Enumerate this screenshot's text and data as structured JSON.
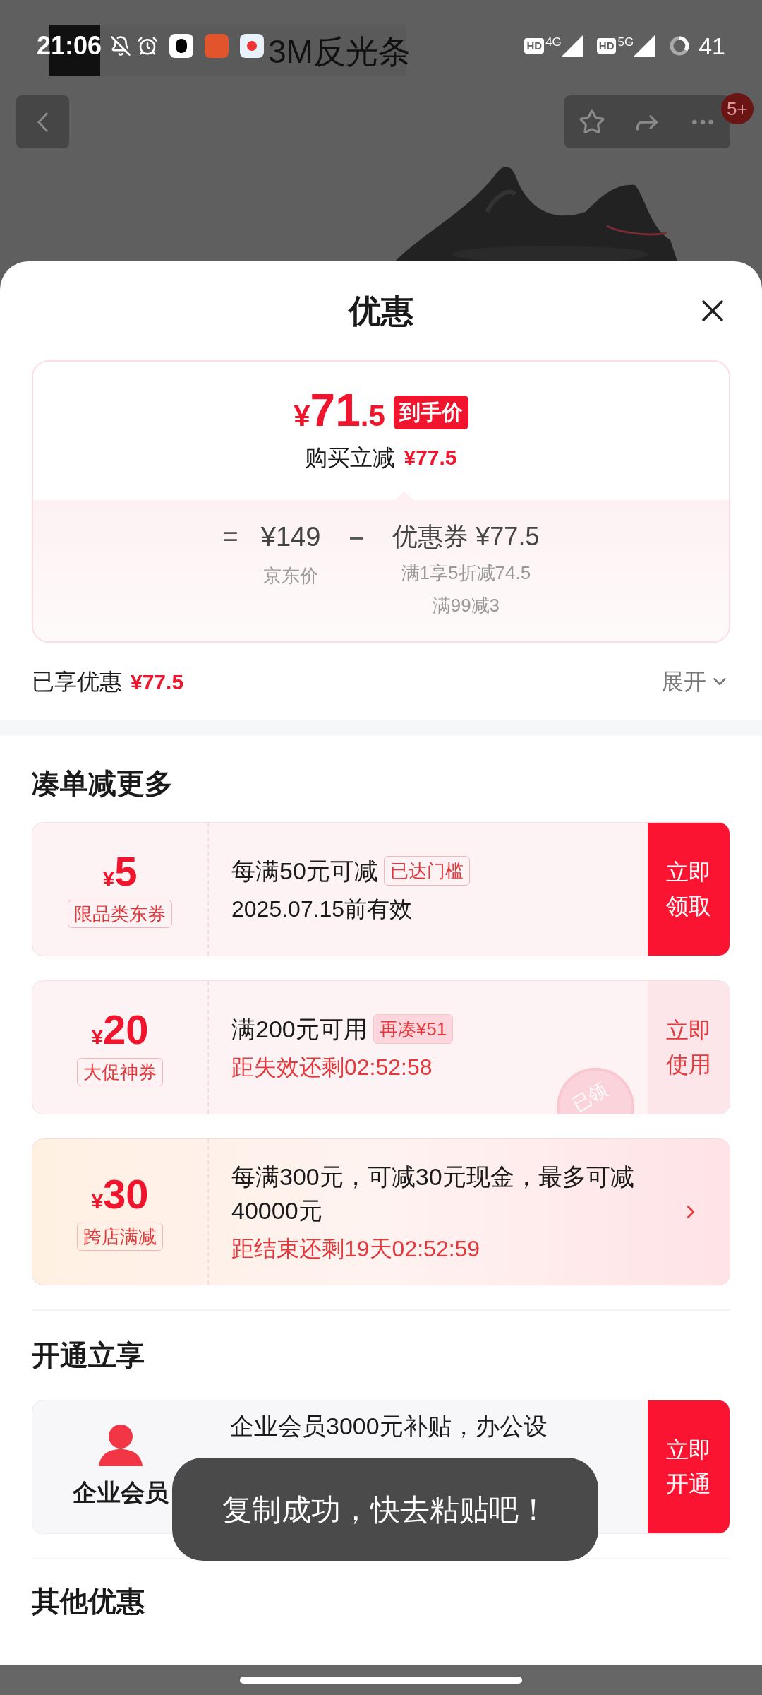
{
  "status_bar": {
    "time": "21:06",
    "signals": [
      {
        "hd": "HD",
        "type": "4G"
      },
      {
        "hd": "HD",
        "type": "5G"
      }
    ],
    "battery": "41"
  },
  "product_page": {
    "banner_text": "3M反光条",
    "badge": "5+"
  },
  "sheet": {
    "title": "优惠",
    "price_card": {
      "symbol": "¥",
      "integer": "71",
      "decimal": ".5",
      "final_label": "到手价",
      "instant_label": "购买立减",
      "instant_value": "¥77.5",
      "formula": {
        "equals": "=",
        "base_price": "¥149",
        "base_label": "京东价",
        "minus": "－",
        "discount": "优惠券 ¥77.5",
        "discount_details": [
          "满1享5折减74.5",
          "满99减3"
        ]
      }
    },
    "enjoyed": {
      "label": "已享优惠",
      "value": "¥77.5",
      "expand": "展开"
    },
    "bundle_section": {
      "title": "凑单减更多",
      "coupons": [
        {
          "kind": "ticket",
          "symbol": "¥",
          "amount": "5",
          "tag": "限品类东券",
          "title": "每满50元可减",
          "badge": "已达门槛",
          "badge_outlined": true,
          "subtitle": "2025.07.15前有效",
          "subtitle_alert": false,
          "action": "立即领取",
          "action_solid": true
        },
        {
          "kind": "ticket",
          "symbol": "¥",
          "amount": "20",
          "tag": "大促神券",
          "title": "满200元可用",
          "badge": "再凑¥51",
          "badge_outlined": false,
          "subtitle": "距失效还剩02:52:58",
          "subtitle_alert": true,
          "action": "立即使用",
          "action_solid": false,
          "stamp": "已领"
        },
        {
          "kind": "promo",
          "symbol": "¥",
          "amount": "30",
          "tag": "跨店满减",
          "title": "每满300元，可减30元现金，最多可减40000元",
          "subtitle": "距结束还剩19天02:52:59",
          "subtitle_alert": true
        }
      ]
    },
    "member_section": {
      "title": "开通立享",
      "card": {
        "name": "企业会员",
        "description": "企业会员3000元补贴，办公设",
        "action": "立即开通"
      }
    },
    "other_section": {
      "title": "其他优惠"
    },
    "toast": "复制成功，快去粘贴吧！"
  }
}
